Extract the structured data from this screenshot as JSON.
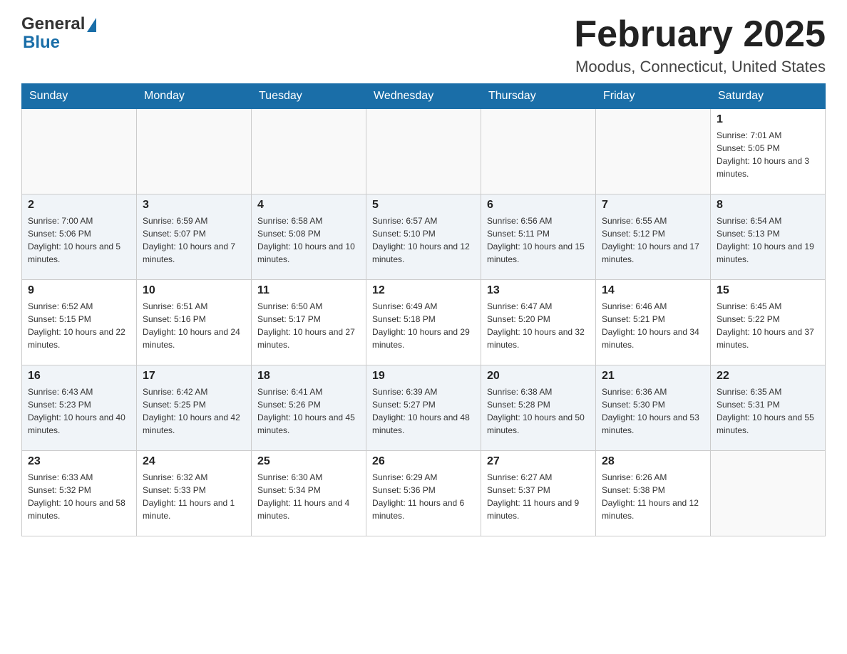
{
  "header": {
    "logo_general": "General",
    "logo_blue": "Blue",
    "month_year": "February 2025",
    "location": "Moodus, Connecticut, United States"
  },
  "weekdays": [
    "Sunday",
    "Monday",
    "Tuesday",
    "Wednesday",
    "Thursday",
    "Friday",
    "Saturday"
  ],
  "weeks": [
    [
      {
        "day": "",
        "info": ""
      },
      {
        "day": "",
        "info": ""
      },
      {
        "day": "",
        "info": ""
      },
      {
        "day": "",
        "info": ""
      },
      {
        "day": "",
        "info": ""
      },
      {
        "day": "",
        "info": ""
      },
      {
        "day": "1",
        "info": "Sunrise: 7:01 AM\nSunset: 5:05 PM\nDaylight: 10 hours and 3 minutes."
      }
    ],
    [
      {
        "day": "2",
        "info": "Sunrise: 7:00 AM\nSunset: 5:06 PM\nDaylight: 10 hours and 5 minutes."
      },
      {
        "day": "3",
        "info": "Sunrise: 6:59 AM\nSunset: 5:07 PM\nDaylight: 10 hours and 7 minutes."
      },
      {
        "day": "4",
        "info": "Sunrise: 6:58 AM\nSunset: 5:08 PM\nDaylight: 10 hours and 10 minutes."
      },
      {
        "day": "5",
        "info": "Sunrise: 6:57 AM\nSunset: 5:10 PM\nDaylight: 10 hours and 12 minutes."
      },
      {
        "day": "6",
        "info": "Sunrise: 6:56 AM\nSunset: 5:11 PM\nDaylight: 10 hours and 15 minutes."
      },
      {
        "day": "7",
        "info": "Sunrise: 6:55 AM\nSunset: 5:12 PM\nDaylight: 10 hours and 17 minutes."
      },
      {
        "day": "8",
        "info": "Sunrise: 6:54 AM\nSunset: 5:13 PM\nDaylight: 10 hours and 19 minutes."
      }
    ],
    [
      {
        "day": "9",
        "info": "Sunrise: 6:52 AM\nSunset: 5:15 PM\nDaylight: 10 hours and 22 minutes."
      },
      {
        "day": "10",
        "info": "Sunrise: 6:51 AM\nSunset: 5:16 PM\nDaylight: 10 hours and 24 minutes."
      },
      {
        "day": "11",
        "info": "Sunrise: 6:50 AM\nSunset: 5:17 PM\nDaylight: 10 hours and 27 minutes."
      },
      {
        "day": "12",
        "info": "Sunrise: 6:49 AM\nSunset: 5:18 PM\nDaylight: 10 hours and 29 minutes."
      },
      {
        "day": "13",
        "info": "Sunrise: 6:47 AM\nSunset: 5:20 PM\nDaylight: 10 hours and 32 minutes."
      },
      {
        "day": "14",
        "info": "Sunrise: 6:46 AM\nSunset: 5:21 PM\nDaylight: 10 hours and 34 minutes."
      },
      {
        "day": "15",
        "info": "Sunrise: 6:45 AM\nSunset: 5:22 PM\nDaylight: 10 hours and 37 minutes."
      }
    ],
    [
      {
        "day": "16",
        "info": "Sunrise: 6:43 AM\nSunset: 5:23 PM\nDaylight: 10 hours and 40 minutes."
      },
      {
        "day": "17",
        "info": "Sunrise: 6:42 AM\nSunset: 5:25 PM\nDaylight: 10 hours and 42 minutes."
      },
      {
        "day": "18",
        "info": "Sunrise: 6:41 AM\nSunset: 5:26 PM\nDaylight: 10 hours and 45 minutes."
      },
      {
        "day": "19",
        "info": "Sunrise: 6:39 AM\nSunset: 5:27 PM\nDaylight: 10 hours and 48 minutes."
      },
      {
        "day": "20",
        "info": "Sunrise: 6:38 AM\nSunset: 5:28 PM\nDaylight: 10 hours and 50 minutes."
      },
      {
        "day": "21",
        "info": "Sunrise: 6:36 AM\nSunset: 5:30 PM\nDaylight: 10 hours and 53 minutes."
      },
      {
        "day": "22",
        "info": "Sunrise: 6:35 AM\nSunset: 5:31 PM\nDaylight: 10 hours and 55 minutes."
      }
    ],
    [
      {
        "day": "23",
        "info": "Sunrise: 6:33 AM\nSunset: 5:32 PM\nDaylight: 10 hours and 58 minutes."
      },
      {
        "day": "24",
        "info": "Sunrise: 6:32 AM\nSunset: 5:33 PM\nDaylight: 11 hours and 1 minute."
      },
      {
        "day": "25",
        "info": "Sunrise: 6:30 AM\nSunset: 5:34 PM\nDaylight: 11 hours and 4 minutes."
      },
      {
        "day": "26",
        "info": "Sunrise: 6:29 AM\nSunset: 5:36 PM\nDaylight: 11 hours and 6 minutes."
      },
      {
        "day": "27",
        "info": "Sunrise: 6:27 AM\nSunset: 5:37 PM\nDaylight: 11 hours and 9 minutes."
      },
      {
        "day": "28",
        "info": "Sunrise: 6:26 AM\nSunset: 5:38 PM\nDaylight: 11 hours and 12 minutes."
      },
      {
        "day": "",
        "info": ""
      }
    ]
  ]
}
